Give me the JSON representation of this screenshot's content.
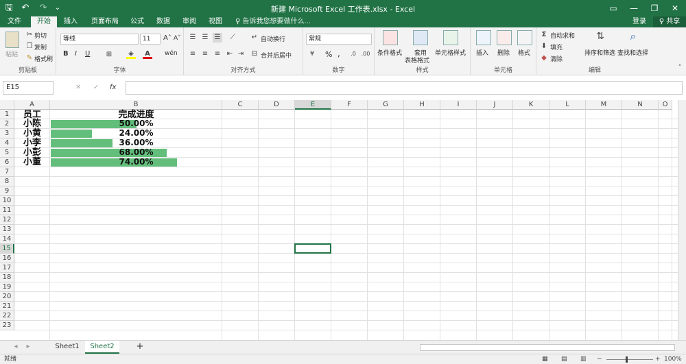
{
  "window": {
    "title": "新建 Microsoft Excel 工作表.xlsx - Excel",
    "controls": [
      "▭",
      "—",
      "❐",
      "✕"
    ]
  },
  "quick_access": {
    "save": "🖫",
    "undo": "↶",
    "redo": "↷",
    "more": "⌄"
  },
  "menu": {
    "tabs": [
      "文件",
      "开始",
      "插入",
      "页面布局",
      "公式",
      "数据",
      "审阅",
      "视图"
    ],
    "active": "开始",
    "search_placeholder": "♀ 告诉我您想要做什么...",
    "login": "登录",
    "share": "♀ 共享"
  },
  "ribbon": {
    "clipboard": {
      "label": "剪贴板",
      "paste": "粘贴",
      "cut": "剪切",
      "copy": "复制",
      "format_painter": "格式刷"
    },
    "font": {
      "label": "字体",
      "name": "等线",
      "size": "11",
      "grow": "A˄",
      "shrink": "A˅",
      "bold": "B",
      "italic": "I",
      "underline": "U",
      "phonetic": "wén"
    },
    "alignment": {
      "label": "对齐方式",
      "wrap": "自动换行",
      "merge": "合并后居中"
    },
    "number": {
      "label": "数字",
      "format": "常规",
      "percent": "%",
      "comma": ","
    },
    "styles": {
      "label": "样式",
      "conditional": "条件格式",
      "table_line1": "套用",
      "table_line2": "表格格式",
      "cell_styles": "单元格样式"
    },
    "cells": {
      "label": "单元格",
      "insert": "插入",
      "delete": "删除",
      "format": "格式"
    },
    "editing": {
      "label": "编辑",
      "autosum": "自动求和",
      "fill": "填充",
      "clear": "清除",
      "sort": "排序和筛选",
      "find": "查找和选择"
    }
  },
  "formula_bar": {
    "name_box": "E15",
    "fx": "fx",
    "cancel": "✕",
    "confirm": "✓"
  },
  "columns": [
    "A",
    "B",
    "C",
    "D",
    "E",
    "F",
    "G",
    "H",
    "I",
    "J",
    "K",
    "L",
    "M",
    "N",
    "O"
  ],
  "rows": [
    "1",
    "2",
    "3",
    "4",
    "5",
    "6",
    "7",
    "8",
    "9",
    "10",
    "11",
    "12",
    "13",
    "14",
    "15",
    "16",
    "17",
    "18",
    "19",
    "20",
    "21",
    "22",
    "23"
  ],
  "table": {
    "headers": [
      "员工",
      "完成进度"
    ],
    "rows": [
      {
        "name": "小陈",
        "progress": "50.00%",
        "value": 0.5
      },
      {
        "name": "小黄",
        "progress": "24.00%",
        "value": 0.24
      },
      {
        "name": "小李",
        "progress": "36.00%",
        "value": 0.36
      },
      {
        "name": "小彭",
        "progress": "68.00%",
        "value": 0.68
      },
      {
        "name": "小董",
        "progress": "74.00%",
        "value": 0.74
      }
    ]
  },
  "sheets": [
    "Sheet1",
    "Sheet2"
  ],
  "active_sheet": "Sheet2",
  "add_sheet": "+",
  "status": {
    "ready": "就绪",
    "zoom": "100%"
  },
  "colors": {
    "accent": "#217346",
    "bar": "#63be7b"
  }
}
